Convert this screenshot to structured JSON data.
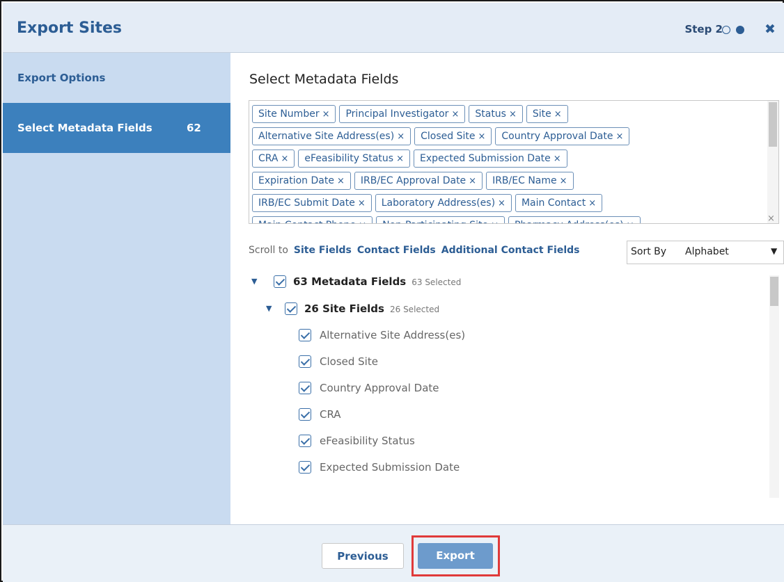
{
  "header": {
    "title": "Export Sites",
    "step_label": "Step 2",
    "close_icon": "close-icon"
  },
  "sidebar": {
    "items": [
      {
        "label": "Export Options",
        "count": ""
      },
      {
        "label": "Select Metadata Fields",
        "count": "62"
      }
    ]
  },
  "main": {
    "section_title": "Select Metadata Fields",
    "chips": [
      [
        "Site Number",
        "Principal Investigator",
        "Status",
        "Site"
      ],
      [
        "Alternative Site Address(es)",
        "Closed Site",
        "Country Approval Date"
      ],
      [
        "CRA",
        "eFeasibility Status",
        "Expected Submission Date"
      ],
      [
        "Expiration Date",
        "IRB/EC Approval Date",
        "IRB/EC Name"
      ],
      [
        "IRB/EC Submit Date",
        "Laboratory Address(es)",
        "Main Contact"
      ],
      [
        "Main Contact Phone",
        "Non-Participating Site",
        "Pharmacy Address(es)"
      ]
    ],
    "chip_remove_glyph": "×",
    "clear_glyph": "×",
    "scroll_to_label": "Scroll to",
    "scroll_links": [
      "Site Fields",
      "Contact Fields",
      "Additional Contact Fields"
    ],
    "sort_label": "Sort By",
    "sort_value": "Alphabet",
    "tree": {
      "root_label": "63 Metadata Fields",
      "root_selected": "63 Selected",
      "group_label": "26 Site Fields",
      "group_selected": "26 Selected",
      "fields": [
        "Alternative Site Address(es)",
        "Closed Site",
        "Country Approval Date",
        "CRA",
        "eFeasibility Status",
        "Expected Submission Date"
      ]
    }
  },
  "footer": {
    "previous_label": "Previous",
    "export_label": "Export"
  },
  "colors": {
    "accent": "#2c5d94",
    "sidebar_bg": "#c9dbf0",
    "sidebar_active": "#3c80bd",
    "export_button": "#6d9bcc",
    "highlight": "#e03a3a"
  }
}
